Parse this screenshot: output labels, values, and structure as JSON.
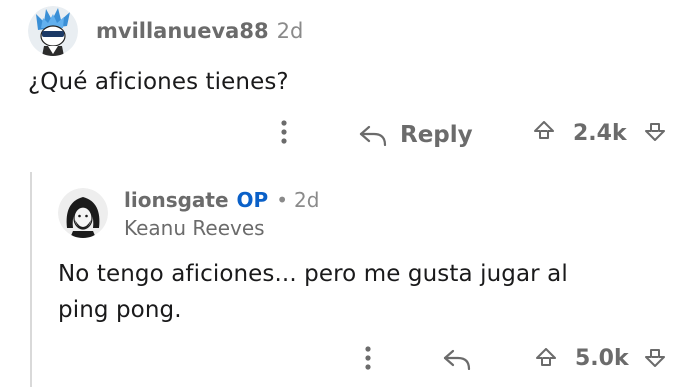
{
  "parent_comment": {
    "username": "mvillanueva88",
    "age": "2d",
    "body": "¿Qué aficiones tienes?",
    "reply_label": "Reply",
    "score": "2.4k"
  },
  "reply_comment": {
    "username": "lionsgate",
    "op_badge": "OP",
    "separator": "•",
    "age": "2d",
    "flair": "Keanu Reeves",
    "body_line1": "No tengo aficiones... pero me gusta jugar al",
    "body_line2": "ping pong.",
    "score": "5.0k"
  },
  "colors": {
    "meta_gray": "#6b6b6b",
    "op_blue": "#0a60c8",
    "thread_line": "#d9d9d9"
  },
  "icons": [
    "more-vertical-icon",
    "reply-arrow-icon",
    "upvote-icon",
    "downvote-icon"
  ]
}
